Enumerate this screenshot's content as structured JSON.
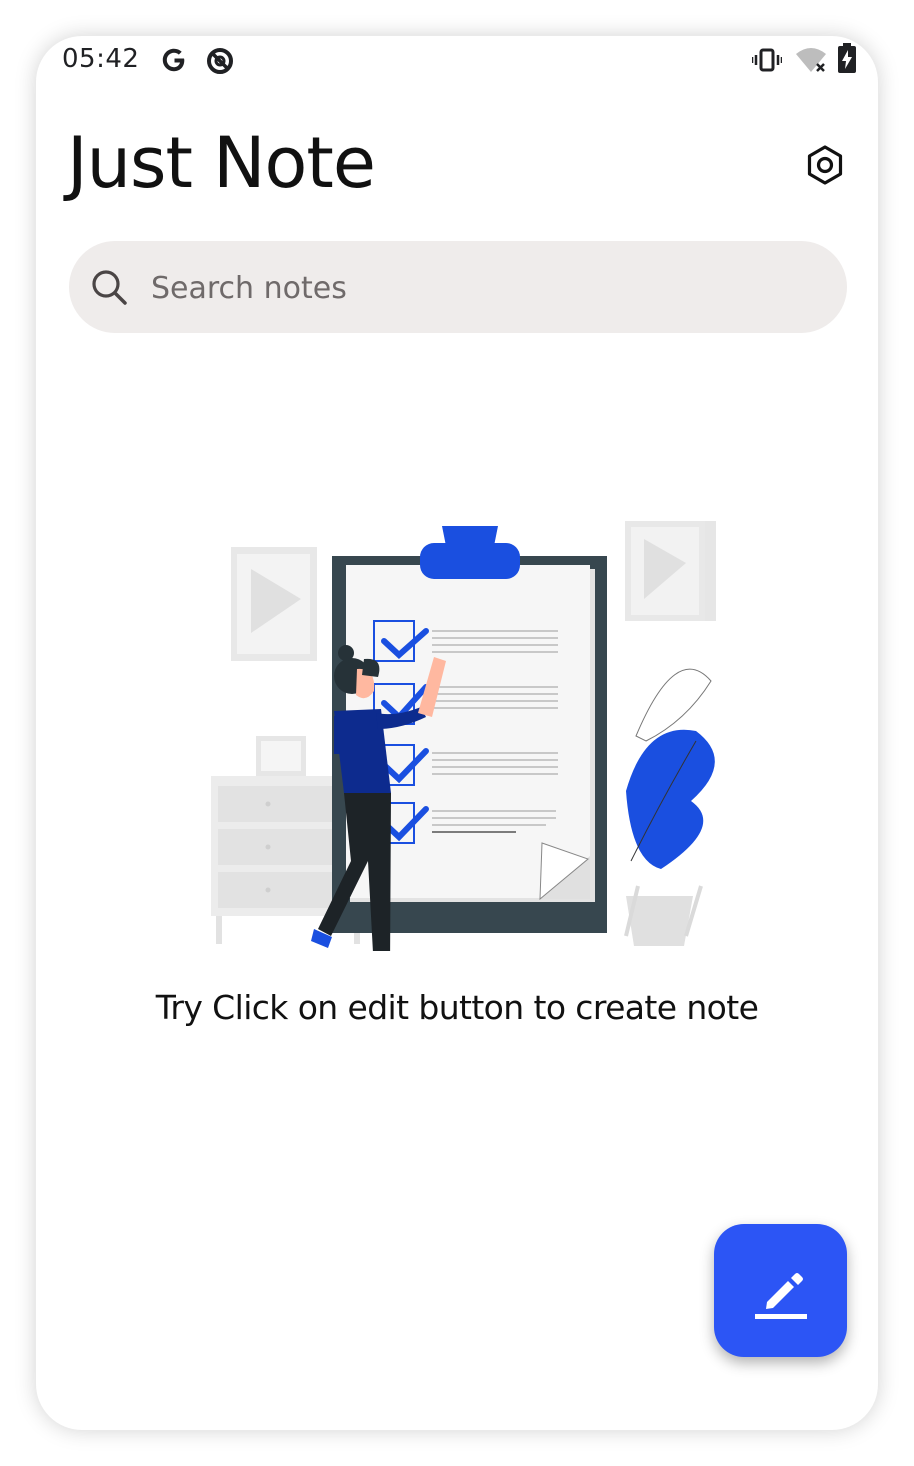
{
  "status_bar": {
    "time": "05:42",
    "icons": [
      "google-icon",
      "data-saver-icon",
      "vibrate-icon",
      "wifi-off-icon",
      "battery-charging-icon"
    ]
  },
  "header": {
    "title": "Just Note",
    "settings_icon": "settings-hexagon-icon"
  },
  "search": {
    "placeholder": "Search notes",
    "value": "",
    "icon": "search-icon"
  },
  "empty_state": {
    "illustration": "checklist-illustration",
    "message": "Try Click on edit button to create note"
  },
  "fab": {
    "icon": "edit-pencil-icon"
  },
  "colors": {
    "accent": "#2c55f5",
    "search_bg": "#efeceb",
    "text": "#111111",
    "illustration_blue": "#1a4fe0",
    "illustration_dark": "#37474f"
  }
}
